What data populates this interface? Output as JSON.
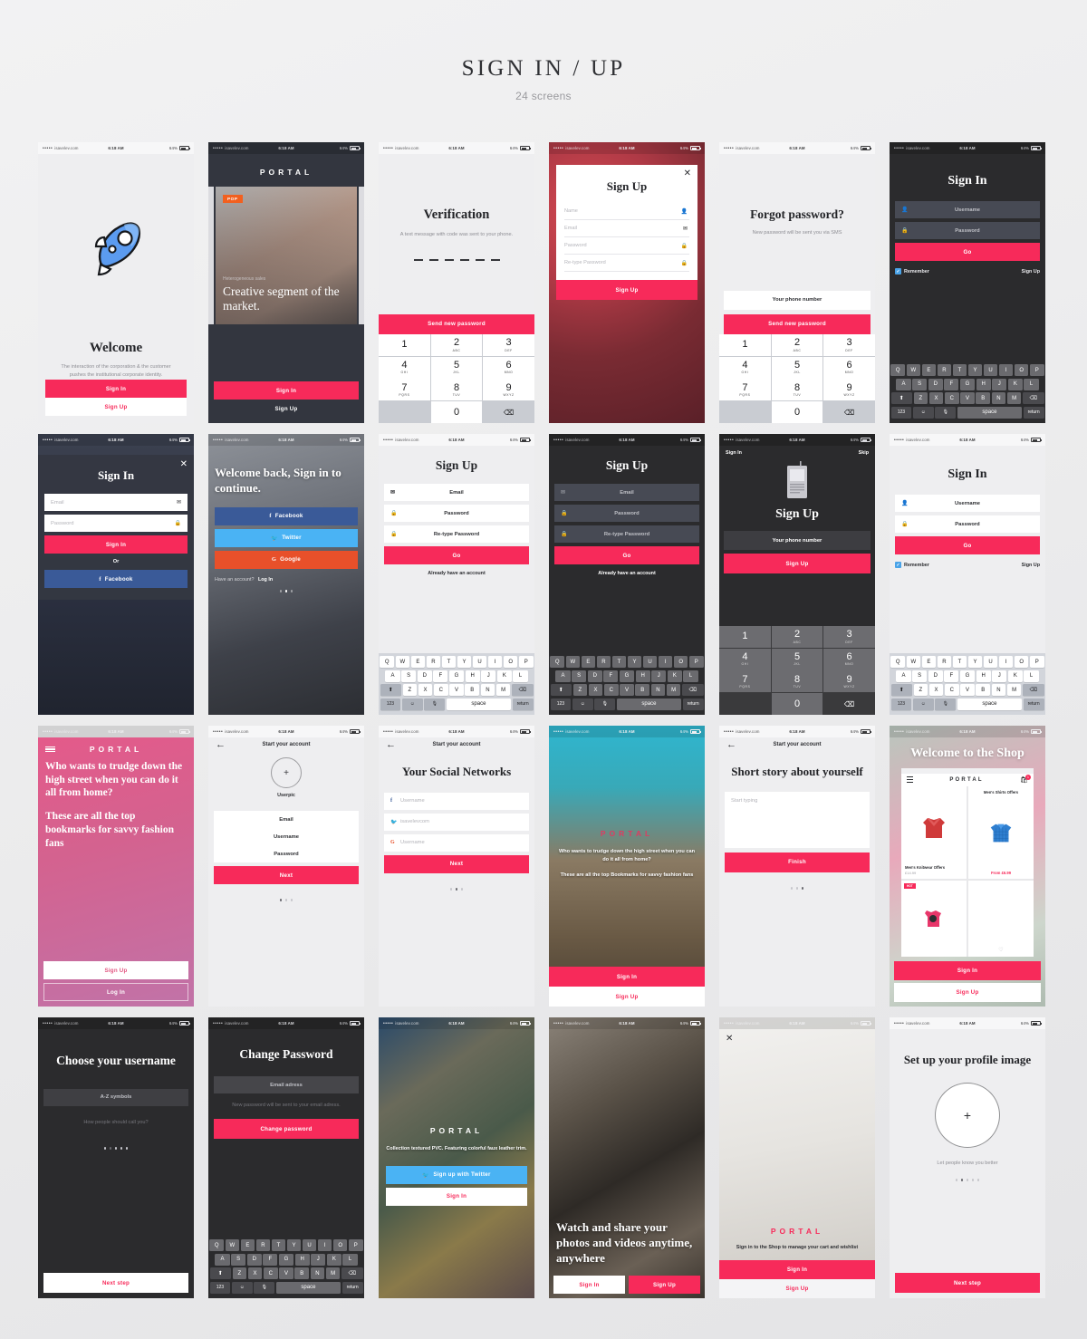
{
  "header": {
    "title": "SIGN IN / UP",
    "subtitle": "24 screens"
  },
  "colors": {
    "accent": "#f72a5a",
    "dark": "#33363f",
    "facebook": "#3a5a98",
    "twitter": "#4ab3f4",
    "google": "#e8502a"
  },
  "status_bar": {
    "carrier": "isavelev.com",
    "time": "6:18 AM",
    "battery": "64%",
    "signal_dots": "•••••"
  },
  "keyboard": {
    "row1": [
      "Q",
      "W",
      "E",
      "R",
      "T",
      "Y",
      "U",
      "I",
      "O",
      "P"
    ],
    "row2": [
      "A",
      "S",
      "D",
      "F",
      "G",
      "H",
      "J",
      "K",
      "L"
    ],
    "row3": [
      "Z",
      "X",
      "C",
      "V",
      "B",
      "N",
      "M"
    ],
    "shift": "⬆",
    "backspace": "⌫",
    "numbers": "123",
    "emoji": "☺",
    "mic": "🎤",
    "space": "space",
    "return": "return"
  },
  "numpad": [
    {
      "n": "1",
      "l": ""
    },
    {
      "n": "2",
      "l": "ABC"
    },
    {
      "n": "3",
      "l": "DEF"
    },
    {
      "n": "4",
      "l": "GHI"
    },
    {
      "n": "5",
      "l": "JKL"
    },
    {
      "n": "6",
      "l": "MNO"
    },
    {
      "n": "7",
      "l": "PQRS"
    },
    {
      "n": "8",
      "l": "TUV"
    },
    {
      "n": "9",
      "l": "WXYZ"
    },
    {
      "n": "0",
      "l": ""
    }
  ],
  "screens": {
    "s1": {
      "name": "welcome",
      "title": "Welcome",
      "body": "The interaction of the corporation & the customer pushes the institutional corporate identity.",
      "primary": "Sign In",
      "secondary": "Sign Up"
    },
    "s2": {
      "name": "portal-carousel",
      "wordmark": "PORTAL",
      "badge": "POP",
      "kicker": "Heterogeneous sales",
      "headline": "Creative segment of the market.",
      "primary": "Sign In",
      "secondary": "Sign Up"
    },
    "s3": {
      "name": "verification",
      "title": "Verification",
      "body": "A text message  with code was sent to your phone.",
      "primary": "Send new password"
    },
    "s4": {
      "name": "signup-modal",
      "title": "Sign Up",
      "fields": [
        "Name",
        "Email",
        "Password",
        "Re-type Password"
      ],
      "primary": "Sign Up"
    },
    "s5": {
      "name": "forgot-password",
      "title": "Forgot password?",
      "body": "New password will be sent you via SMS",
      "field": "Your phone number",
      "primary": "Send new password"
    },
    "s6": {
      "name": "signin-dark-keyboard",
      "title": "Sign In",
      "username": "Username",
      "password": "Password",
      "primary": "Go",
      "remember": "Remember",
      "link": "Sign Up"
    },
    "s7": {
      "name": "signin-modal-city",
      "title": "Sign In",
      "email": "Email",
      "password": "Password",
      "primary": "Sign In",
      "or": "Or",
      "facebook": "Facebook"
    },
    "s8": {
      "name": "welcome-back-social",
      "headline": "Welcome back, Sign in to continue.",
      "facebook": "Facebook",
      "twitter": "Twitter",
      "google": "Google",
      "footer_prefix": "Have an account?",
      "footer_link": "Log In"
    },
    "s9": {
      "name": "signup-light-keyboard",
      "title": "Sign Up",
      "fields": [
        "Email",
        "Password",
        "Re-type Password"
      ],
      "primary": "Go",
      "footer": "Already have an account"
    },
    "s10": {
      "name": "signup-dark-keyboard",
      "title": "Sign Up",
      "fields": [
        "Email",
        "Password",
        "Re-type Password"
      ],
      "primary": "Go",
      "footer": "Already have an account"
    },
    "s11": {
      "name": "signup-phone-numpad",
      "top_left": "Sign In",
      "top_right": "Skip",
      "title": "Sign Up",
      "field": "Your phone number",
      "primary": "Sign Up"
    },
    "s12": {
      "name": "signin-light-keyboard",
      "title": "Sign In",
      "username": "Username",
      "password": "Password",
      "primary": "Go",
      "remember": "Remember",
      "link": "Sign Up"
    },
    "s13": {
      "name": "portal-pink-intro",
      "wordmark": "PORTAL",
      "p1": "Who wants to trudge down the high street when you can do it all from home?",
      "p2": "These are all the top bookmarks for savvy fashion fans",
      "primary": "Sign Up",
      "secondary": "Log In"
    },
    "s14": {
      "name": "start-account-userpic",
      "topbar": "Start your account",
      "userpic_label": "Userpic",
      "fields": [
        "Email",
        "Username",
        "Password"
      ],
      "primary": "Next"
    },
    "s15": {
      "name": "social-networks",
      "topbar": "Start your account",
      "title": "Your Social Networks",
      "facebook_value": "Username",
      "twitter_value": "isavelevcom",
      "google_value": "Username",
      "primary": "Next"
    },
    "s16": {
      "name": "portal-library-photo",
      "wordmark": "PORTAL",
      "p1": "Who wants to trudge down the high street when you can do it all from home?",
      "p2": "These are all the top Bookmarks for savvy fashion fans",
      "primary": "Sign In",
      "secondary": "Sign Up"
    },
    "s17": {
      "name": "short-story",
      "topbar": "Start your account",
      "title": "Short story about yourself",
      "placeholder": "Start typing",
      "primary": "Finish"
    },
    "s18": {
      "name": "welcome-shop",
      "headline": "Welcome to the Shop",
      "inner_wordmark": "PORTAL",
      "cart_count": "1",
      "products": [
        {
          "title": "Men's Knitwear Offers",
          "price": "£14.99"
        },
        {
          "title": "Men's Shirts Offers",
          "price": "From £6.99"
        },
        {
          "title": "HOT",
          "price": ""
        }
      ],
      "primary": "Sign In",
      "secondary": "Sign Up"
    },
    "s19": {
      "name": "choose-username",
      "title": "Choose your username",
      "field": "A-Z symbols",
      "hint": "How people should call you?",
      "primary": "Next step"
    },
    "s20": {
      "name": "change-password",
      "title": "Change Password",
      "field": "Email adress",
      "hint": "New password will be sent to your email adress.",
      "primary": "Change password"
    },
    "s21": {
      "name": "portal-graffiti",
      "wordmark": "PORTAL",
      "body": "Collection textured PVC. Featuring colorful faux leather trim.",
      "twitter": "Sign up with Twitter",
      "secondary": "Sign In"
    },
    "s22": {
      "name": "watch-and-share",
      "headline": "Watch and share your photos and videos anytime, anywhere",
      "secondary": "Sign In",
      "primary": "Sign Up"
    },
    "s23": {
      "name": "portal-shop-signin",
      "wordmark": "PORTAL",
      "body": "Sign in to the Shop to manage your cart and wishlist",
      "primary": "Sign In",
      "secondary": "Sign Up"
    },
    "s24": {
      "name": "profile-image",
      "title": "Set up your profile image",
      "hint": "Let people know you better",
      "primary": "Next step"
    }
  }
}
